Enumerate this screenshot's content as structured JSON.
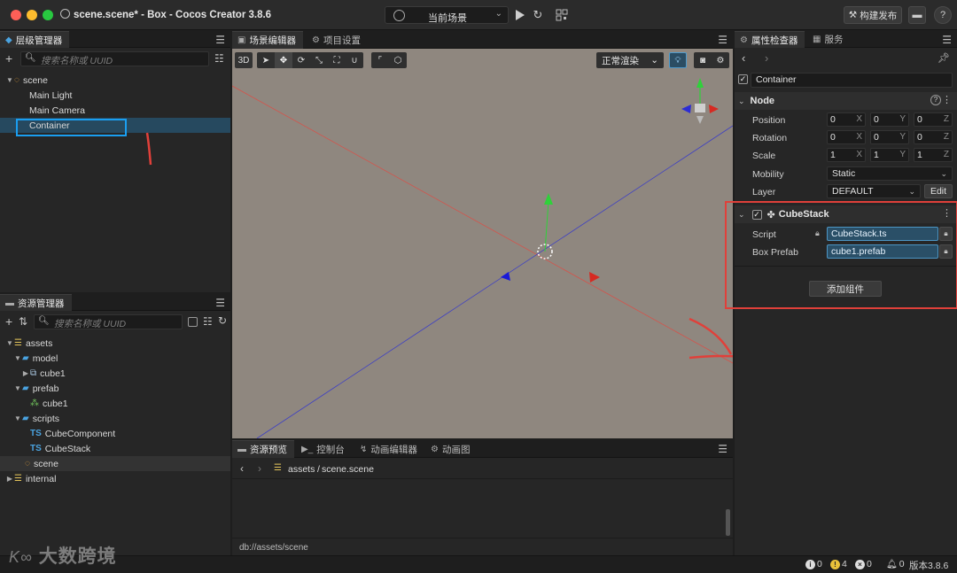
{
  "titlebar": {
    "title": "scene.scene* - Box - Cocos Creator 3.8.6",
    "scene_select": "当前场景",
    "publish": "构建发布"
  },
  "hierarchy": {
    "tab": "层级管理器",
    "search_placeholder": "搜索名称或 UUID",
    "items": [
      "scene",
      "Main Light",
      "Main Camera",
      "Container"
    ]
  },
  "assets": {
    "tab": "资源管理器",
    "search_placeholder": "搜索名称或 UUID",
    "items": [
      "assets",
      "model",
      "cube1",
      "prefab",
      "cube1",
      "scripts",
      "CubeComponent",
      "CubeStack",
      "scene",
      "internal"
    ],
    "ts_badge": "TS"
  },
  "scene_editor": {
    "tabs": [
      "场景编辑器",
      "项目设置"
    ],
    "mode_3d": "3D",
    "render_mode": "正常渲染"
  },
  "console": {
    "tabs": [
      "资源预览",
      "控制台",
      "动画编辑器",
      "动画图"
    ],
    "path_root": "assets",
    "path_file": "scene.scene",
    "db_path": "db://assets/scene"
  },
  "inspector": {
    "tabs": [
      "属性检查器",
      "服务"
    ],
    "node_name": "Container",
    "node_section": "Node",
    "labels": {
      "position": "Position",
      "rotation": "Rotation",
      "scale": "Scale",
      "mobility": "Mobility",
      "layer": "Layer",
      "script": "Script",
      "box_prefab": "Box Prefab"
    },
    "position": [
      "0",
      "0",
      "0"
    ],
    "rotation": [
      "0",
      "0",
      "0"
    ],
    "scale": [
      "1",
      "1",
      "1"
    ],
    "axes": [
      "X",
      "Y",
      "Z"
    ],
    "mobility": "Static",
    "layer": "DEFAULT",
    "edit": "Edit",
    "component": "CubeStack",
    "script_value": "CubeStack.ts",
    "prefab_value": "cube1.prefab",
    "add_component": "添加组件"
  },
  "status": {
    "info": "0",
    "warn": "4",
    "error": "0",
    "notify": "0",
    "version": "版本3.8.6"
  },
  "watermark": "大数跨境",
  "colors": {
    "selection": "#26495f",
    "accent_blue": "#4c95c4",
    "annotation_red": "#e0403a",
    "annotation_cyan": "#1a9ef0"
  }
}
